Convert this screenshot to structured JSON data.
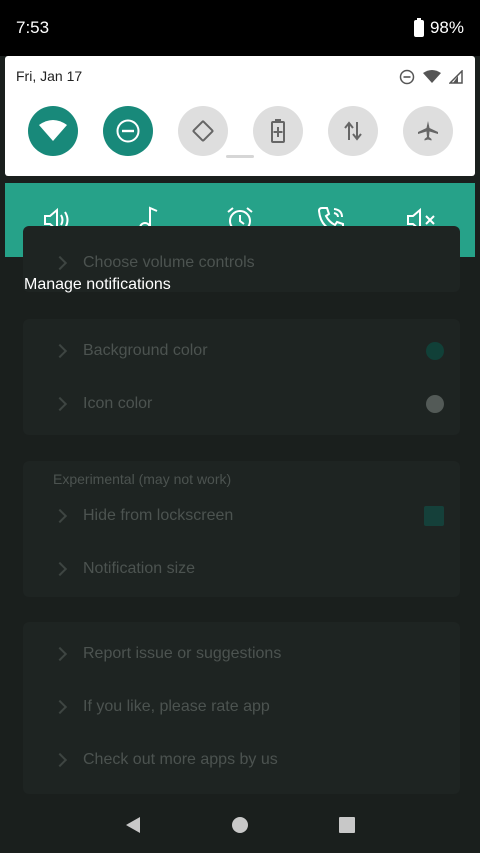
{
  "status_bar": {
    "time": "7:53",
    "battery_percent": "98%"
  },
  "quick_settings": {
    "date": "Fri, Jan 17",
    "tiles": [
      {
        "name": "wifi",
        "state": "on"
      },
      {
        "name": "do-not-disturb",
        "state": "on"
      },
      {
        "name": "auto-rotate",
        "state": "off"
      },
      {
        "name": "battery-saver",
        "state": "off"
      },
      {
        "name": "mobile-data",
        "state": "off"
      },
      {
        "name": "airplane-mode",
        "state": "off"
      }
    ],
    "accent_color": "#18897a"
  },
  "media_controls": {
    "color": "#26a289",
    "buttons": [
      "volume-icon",
      "music-note-icon",
      "alarm-icon",
      "phone-call-icon",
      "mute-icon"
    ]
  },
  "app": {
    "partial_row": "Choose volume controls",
    "section_title": "Manage notifications",
    "appearance_items": [
      {
        "label": "Background color"
      },
      {
        "label": "Icon color"
      }
    ],
    "experimental_header": "Experimental (may not work)",
    "experimental_items": [
      {
        "label": "Hide from lockscreen"
      },
      {
        "label": "Notification size"
      }
    ],
    "other_items": [
      {
        "label": "Report issue or suggestions"
      },
      {
        "label": "If you like, please rate app"
      },
      {
        "label": "Check out more apps by us"
      }
    ]
  }
}
